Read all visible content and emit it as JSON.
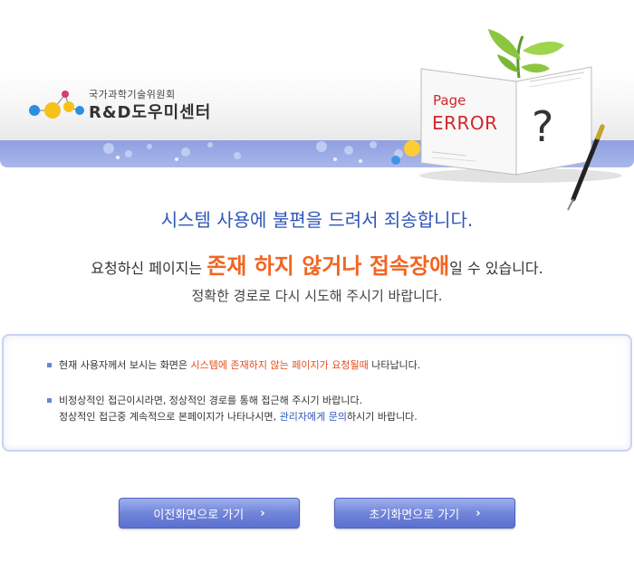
{
  "header": {
    "org_name": "국가과학기술위원회",
    "site_title": "R&D도우미센터"
  },
  "illustration": {
    "page_label": "Page",
    "error_label": "ERROR",
    "mark": "?"
  },
  "messages": {
    "line1": "시스템 사용에 불편을 드려서 죄송합니다.",
    "line2_prefix": "요청하신 페이지는 ",
    "line2_highlight": "존재 하지 않거나 접속장애",
    "line2_suffix": "일 수 있습니다.",
    "line3": "정확한 경로로 다시 시도해 주시기 바랍니다."
  },
  "info": {
    "item1_prefix": "현재 사용자께서 보시는 화면은 ",
    "item1_highlight": "시스템에 존재하지 않는 페이지가 요청될때",
    "item1_suffix": " 나타납니다.",
    "item2_line1": "비정상적인 접근이시라면, 정상적인 경로를 통해 접근해 주시기 바랍니다.",
    "item2_line2_prefix": "정상적인 접근중 계속적으로 본페이지가 나타나시면, ",
    "item2_line2_highlight": "관리자에게 문의",
    "item2_line2_suffix": "하시기 바랍니다."
  },
  "buttons": {
    "prev_label": "이전화면으로 가기",
    "home_label": "초기화면으로 가기",
    "chevron": "›"
  },
  "colors": {
    "accent_blue": "#2f56b8",
    "highlight_orange": "#f26522",
    "error_red": "#d0282b"
  }
}
